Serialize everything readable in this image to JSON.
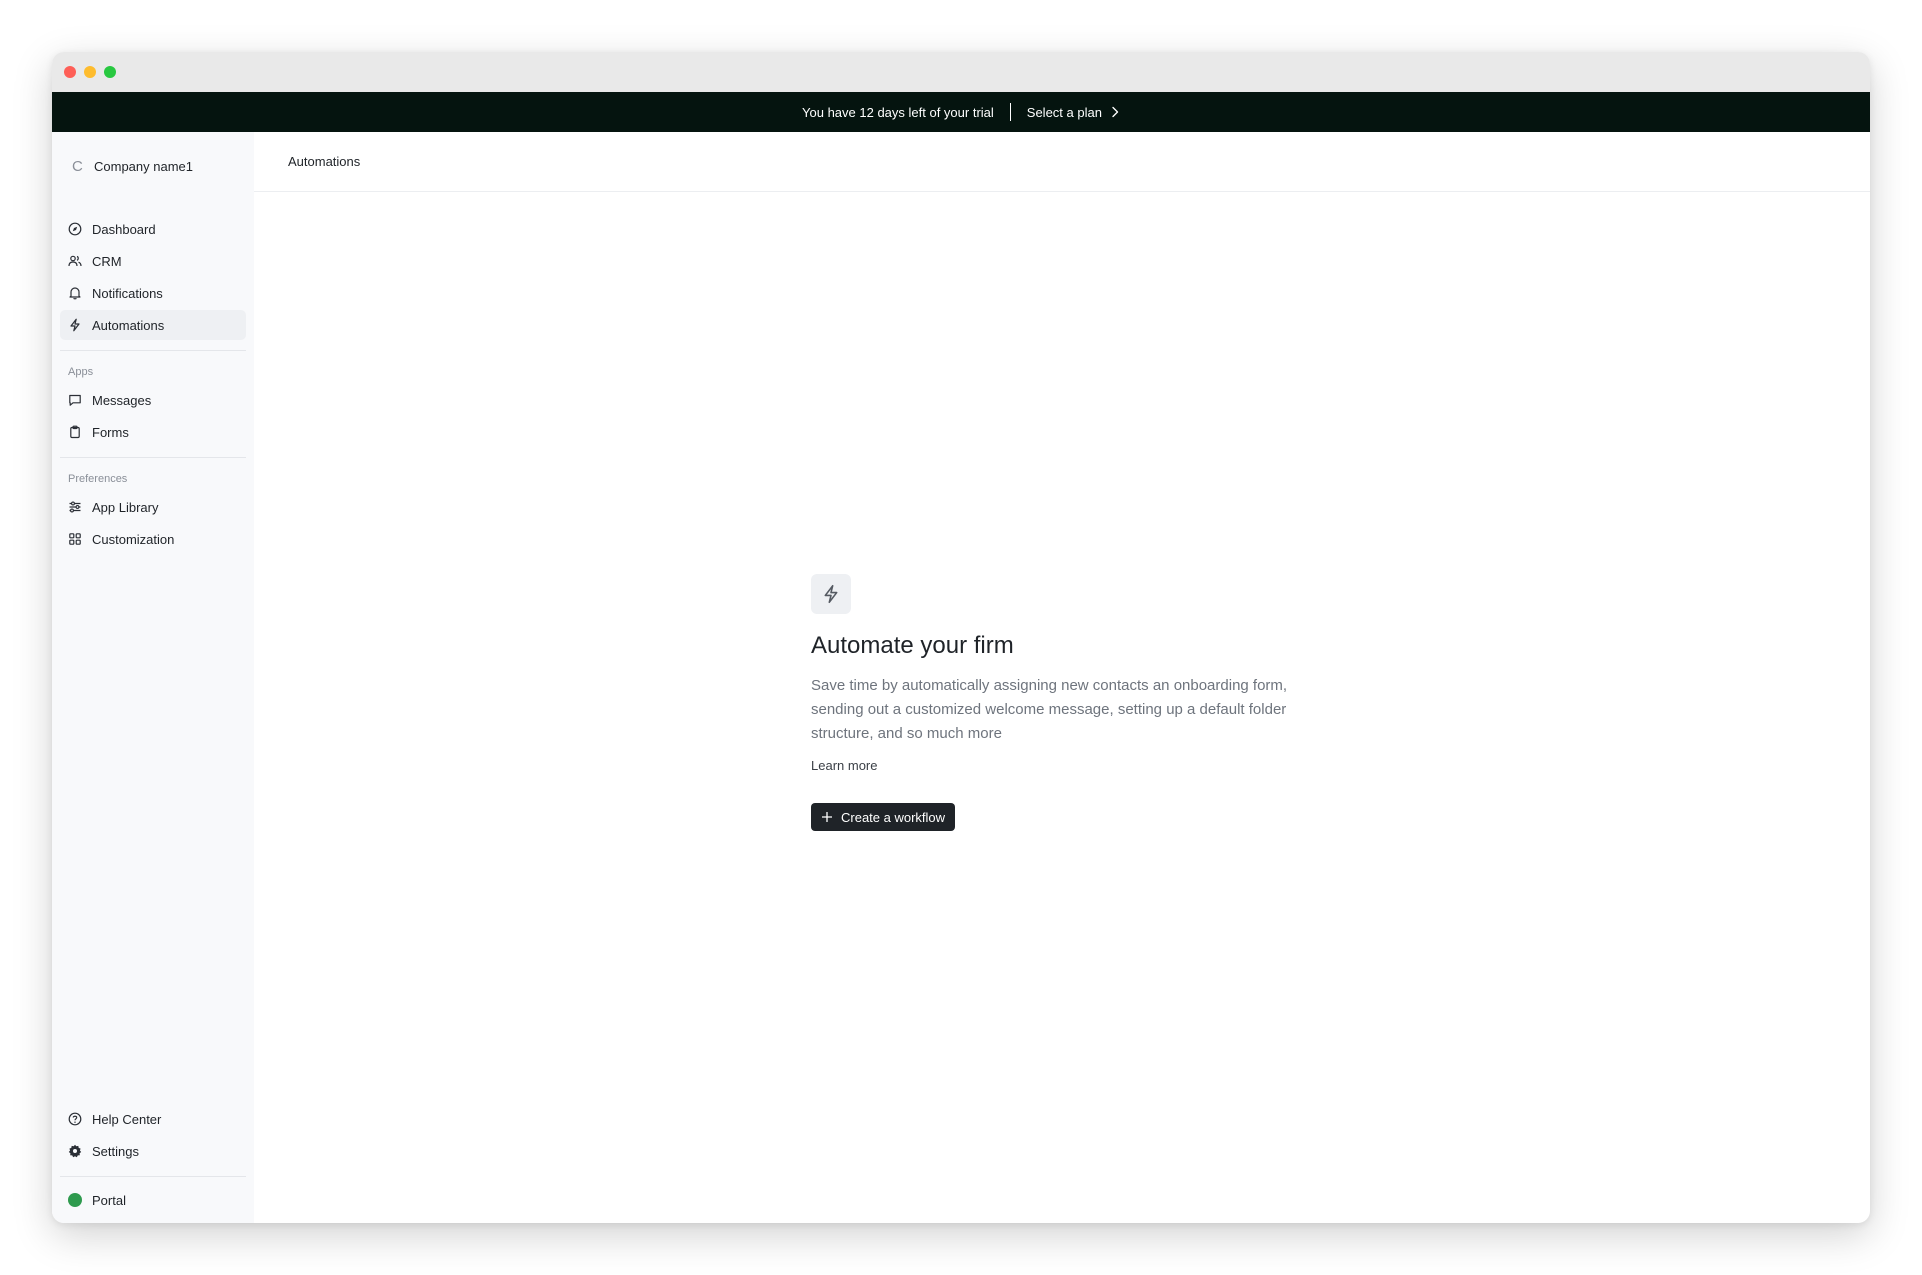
{
  "trial_banner": {
    "message": "You have 12 days left of your trial",
    "plan_link": "Select a plan"
  },
  "sidebar": {
    "company_initial": "C",
    "company_name": "Company name1",
    "main_items": [
      {
        "label": "Dashboard",
        "icon": "compass-icon"
      },
      {
        "label": "CRM",
        "icon": "users-icon"
      },
      {
        "label": "Notifications",
        "icon": "bell-icon"
      },
      {
        "label": "Automations",
        "icon": "lightning-icon",
        "active": true
      }
    ],
    "apps_label": "Apps",
    "apps_items": [
      {
        "label": "Messages",
        "icon": "message-icon"
      },
      {
        "label": "Forms",
        "icon": "clipboard-icon"
      }
    ],
    "preferences_label": "Preferences",
    "preferences_items": [
      {
        "label": "App Library",
        "icon": "sliders-icon"
      },
      {
        "label": "Customization",
        "icon": "grid-icon"
      }
    ],
    "bottom_items": [
      {
        "label": "Help Center",
        "icon": "help-circle-icon"
      },
      {
        "label": "Settings",
        "icon": "gear-icon"
      }
    ],
    "portal_label": "Portal",
    "portal_status_color": "#2e9a4e"
  },
  "main": {
    "header_title": "Automations",
    "empty_state": {
      "icon": "lightning-icon",
      "title": "Automate your firm",
      "description": "Save time by automatically assigning new contacts an onboarding form, sending out a customized welcome message, setting up a default folder structure, and so much more",
      "learn_more": "Learn more",
      "button_label": "Create a workflow"
    }
  },
  "colors": {
    "banner_bg": "#05140f",
    "sidebar_bg": "#f8f9fb",
    "primary_button": "#1f2328"
  }
}
